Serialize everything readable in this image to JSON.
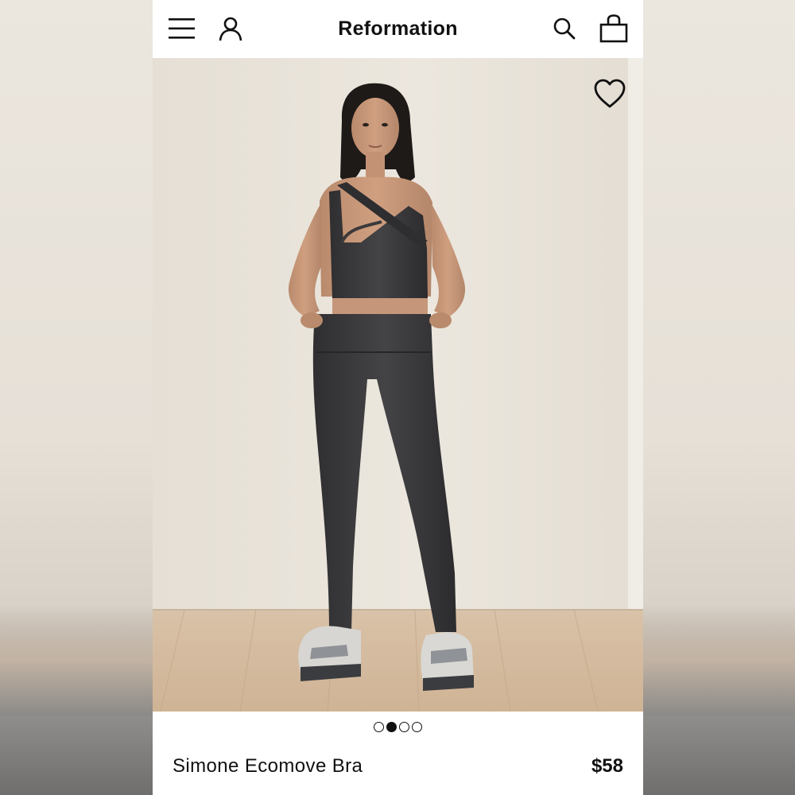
{
  "header": {
    "brand": "Reformation",
    "icons": [
      "menu-icon",
      "account-icon",
      "search-icon",
      "bag-icon"
    ]
  },
  "gallery": {
    "image_description_icon": "model-photo",
    "wishlist_icon": "heart-icon",
    "slides_total": 4,
    "active_slide": 2
  },
  "product": {
    "name": "Simone Ecomove Bra",
    "price": "$58"
  },
  "colors": {
    "header_bg": "#ffffff",
    "text": "#111111",
    "backdrop": "#e8e3da",
    "floor": "#d8bea3",
    "garment": "#3b3a3c"
  }
}
